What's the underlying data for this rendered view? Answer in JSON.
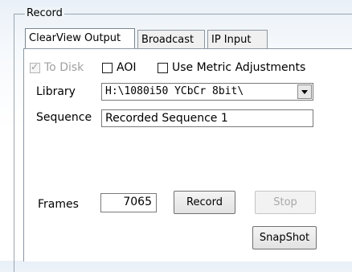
{
  "group": {
    "title": "Record"
  },
  "tabs": [
    {
      "label": "ClearView Output",
      "active": true
    },
    {
      "label": "Broadcast",
      "active": false
    },
    {
      "label": "IP Input",
      "active": false
    }
  ],
  "options": {
    "to_disk": {
      "label": "To Disk",
      "checked": true,
      "enabled": false
    },
    "aoi": {
      "label": "AOI",
      "checked": false
    },
    "metric": {
      "label": "Use Metric Adjustments",
      "checked": false
    }
  },
  "library": {
    "label": "Library",
    "value": "H:\\1080i50 YCbCr 8bit\\"
  },
  "sequence": {
    "label": "Sequence",
    "value": "Recorded Sequence 1"
  },
  "frames": {
    "label": "Frames",
    "value": "7065"
  },
  "buttons": {
    "record": "Record",
    "stop": "Stop",
    "snapshot": "SnapShot"
  }
}
